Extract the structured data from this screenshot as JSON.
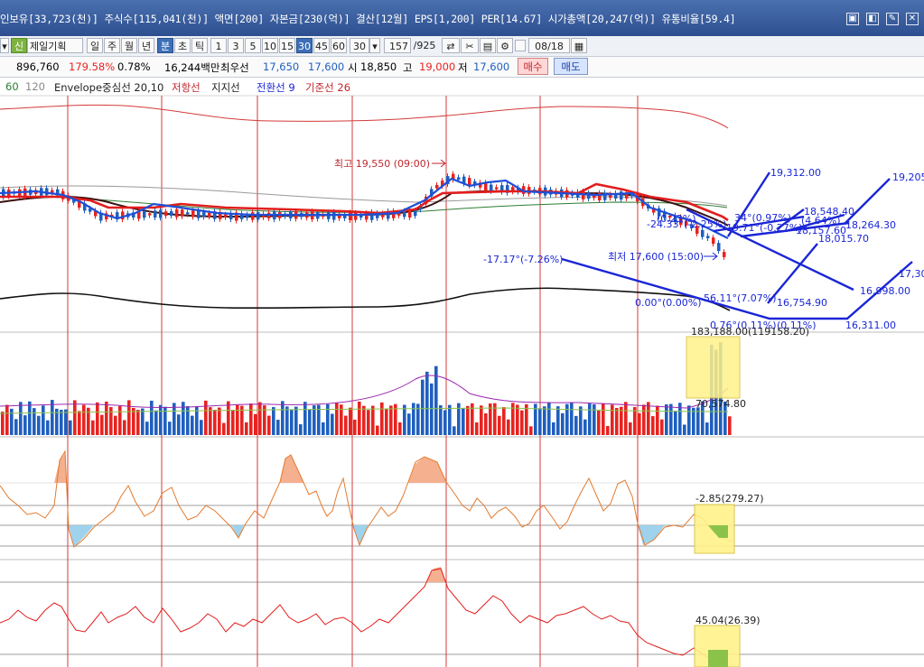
{
  "header": {
    "info_text": "인보유[33,723(천)] 주식수[115,041(천)] 액면[200] 자본금[230(억)] 결산[12월] EPS[1,200] PER[14.67] 시가총액[20,247(억)] 유통비율[59.4]",
    "window_icons": [
      "▣",
      "◧",
      "✎",
      "✕"
    ]
  },
  "toolbar": {
    "badge": "신",
    "stock_name": "제일기획",
    "period_day": "일",
    "period_week": "주",
    "period_month": "월",
    "period_year": "년",
    "period_minute": "분",
    "period_second": "초",
    "period_tick": "틱",
    "intervals": [
      "1",
      "3",
      "5",
      "10",
      "15",
      "30",
      "45",
      "60"
    ],
    "active_interval": "30",
    "interval_select": "30",
    "count": "157",
    "total": "/925",
    "date": "08/18"
  },
  "quote": {
    "volume": "896,760",
    "ratio": "179.58%",
    "turnover": "0.78%",
    "amount": "16,244백만",
    "best_bid_label": "최우선",
    "best_bid": "17,650",
    "best_ask": "17,600",
    "open_label": "시",
    "open": "18,850",
    "high_label": "고",
    "high": "19,000",
    "low_label": "저",
    "low": "17,600",
    "buy_label": "매수",
    "sell_label": "매도"
  },
  "legend": {
    "ma60": "60",
    "ma120": "120",
    "envelope": "Envelope중심선 20,10",
    "resistance": "저항선",
    "support": "지지선",
    "conversion": "전환선 9",
    "base": "기준선 26"
  },
  "annotations": {
    "high": "최고 19,550 (09:00)",
    "low": "최저 17,600 (15:00)",
    "level_19312": "19,312.00",
    "level_19205": "19,205.",
    "level_18548": "18,548.40",
    "level_18264": "18,264.30",
    "level_18157": "18,157.60",
    "level_18015": "18,015.70",
    "level_16998": "16,998.00",
    "level_17300": "17,30",
    "level_16754": "16,754.90",
    "level_16311": "16,311.00",
    "angle_neg17": "-17.17°(-7.26%)",
    "angle_56": "56.11°(7.07%)",
    "angle_0": "0.00°(0.00%)",
    "angle_076": "0.76°(0.11%)",
    "angle_1": "-24.33°(-2.25%)",
    "angle_2": "-19.71°(-0.27%)",
    "angle_3": "34°(0.97%)",
    "angle_4": "(4.64%)",
    "angle_5": "(0.23%)",
    "angle_6": "(0.11%)",
    "volume_label": "70,574.80",
    "volume_top": "183,188.00(119158.20)",
    "osc1_label": "-2.85(279.27)",
    "osc2_label": "45.04(26.39)"
  },
  "colors": {
    "up": "#e8231f",
    "down": "#1f5fbf",
    "highlight": "#fff28a",
    "vline": "#d43a3a",
    "trend": "#1a26d6"
  }
}
